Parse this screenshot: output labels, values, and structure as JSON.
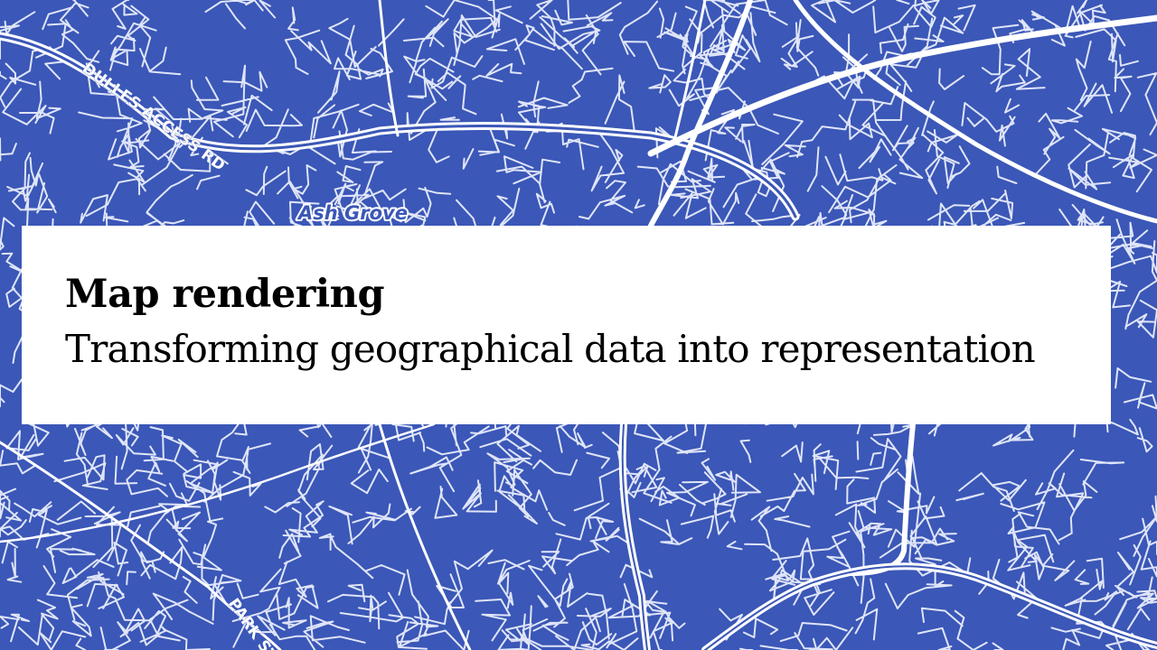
{
  "title_card": {
    "title": "Map rendering",
    "subtitle": "Transforming geographical data into representation"
  },
  "map": {
    "background_color": "#3b57b7",
    "road_color": "#e8ecfb",
    "labels": {
      "dulles": "DULLES ACCESS RD",
      "ash_grove": "Ash Grove",
      "park": "PARK ST"
    }
  }
}
